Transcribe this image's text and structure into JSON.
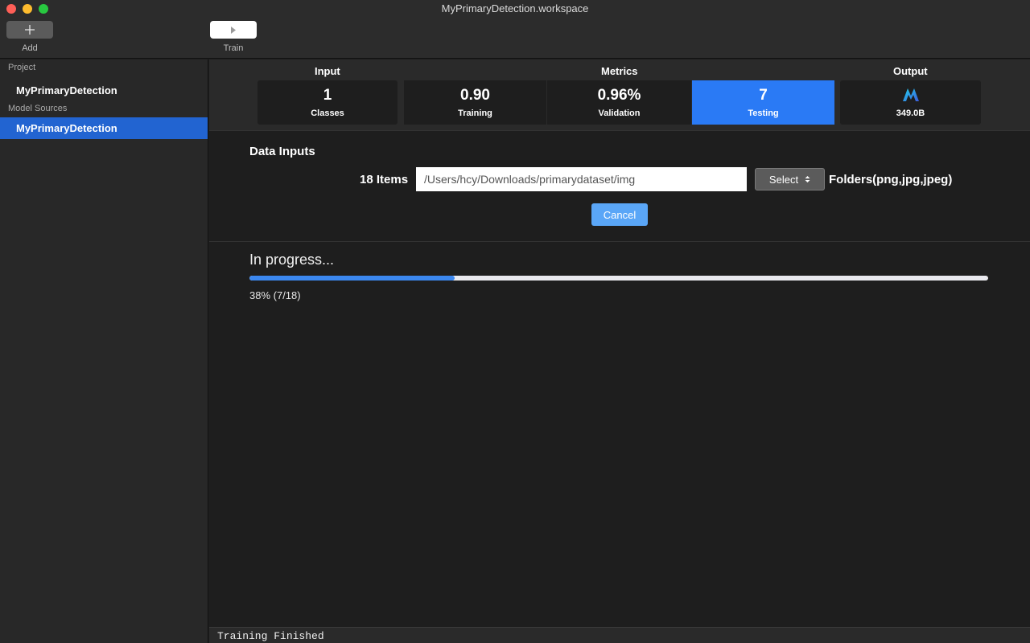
{
  "window": {
    "title": "MyPrimaryDetection.workspace"
  },
  "toolbar": {
    "add_label": "Add",
    "train_label": "Train"
  },
  "sidebar": {
    "project_header": "Project",
    "project_item": "MyPrimaryDetection",
    "sources_header": "Model Sources",
    "sources_item": "MyPrimaryDetection"
  },
  "metrics": {
    "input_header": "Input",
    "metrics_header": "Metrics",
    "output_header": "Output",
    "classes": {
      "value": "1",
      "label": "Classes"
    },
    "training": {
      "value": "0.90",
      "label": "Training"
    },
    "validation": {
      "value": "0.96%",
      "label": "Validation"
    },
    "testing": {
      "value": "7",
      "label": "Testing"
    },
    "output": {
      "value": "349.0B"
    }
  },
  "data_inputs": {
    "title": "Data Inputs",
    "items_label": "18 Items",
    "path_value": "/Users/hcy/Downloads/primarydataset/img",
    "select_label": "Select",
    "formats_label": "Folders(png,jpg,jpeg)",
    "cancel_label": "Cancel"
  },
  "progress": {
    "title": "In progress...",
    "fraction": 0.278,
    "text": "38% (7/18)"
  },
  "status": {
    "text": "Training Finished"
  },
  "colors": {
    "accent": "#2a7af5",
    "sidebar_selected": "#2264d1",
    "progress_fill": "#3b87ef",
    "cancel_button": "#5aa6f7"
  },
  "icons": {
    "add": "plus-icon",
    "train": "play-icon",
    "select": "updown-chevron-icon",
    "output": "model-logo-icon"
  }
}
